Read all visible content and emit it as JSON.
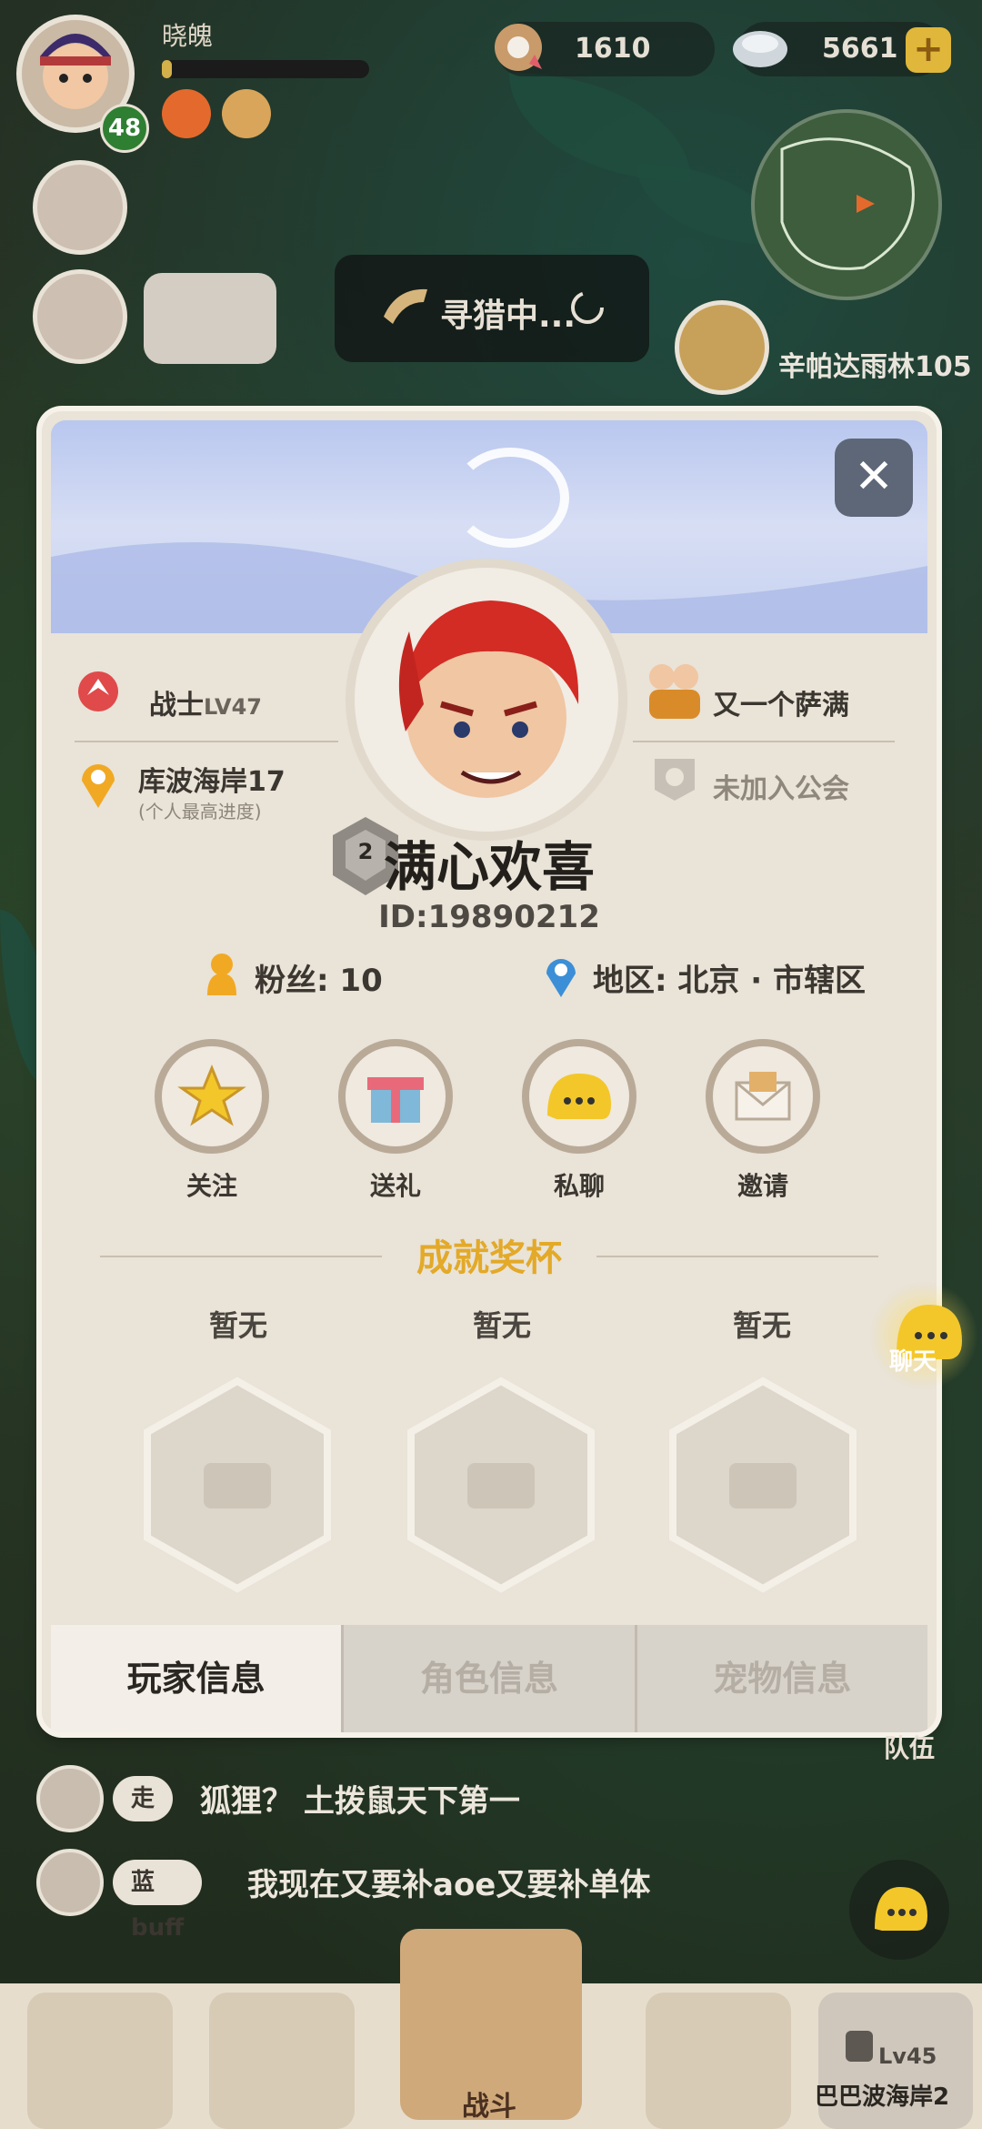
{
  "hud": {
    "player_name": "晓魄",
    "player_level": "48",
    "exp_progress": 0.05,
    "shells": "1610",
    "pearls": "5661",
    "hunting_text": "寻猎中...",
    "location_label": "辛帕达雨林105"
  },
  "profile": {
    "class_label": "战士",
    "class_level": "LV47",
    "best_progress": "库波海岸17",
    "best_progress_sub": "(个人最高进度)",
    "partner_label": "又一个萨满",
    "guild_label": "未加入公会",
    "rank_badge": "2",
    "nickname": "满心欢喜",
    "id_text": "ID:19890212",
    "fans_label": "粉丝: 10",
    "region_label": "地区: 北京 · 市辖区",
    "actions": [
      {
        "label": "关注",
        "icon": "star-icon"
      },
      {
        "label": "送礼",
        "icon": "gift-icon"
      },
      {
        "label": "私聊",
        "icon": "chat-icon"
      },
      {
        "label": "邀请",
        "icon": "invite-icon"
      }
    ],
    "achievement_title": "成就奖杯",
    "trophies": [
      "暂无",
      "暂无",
      "暂无"
    ],
    "tabs": [
      "玩家信息",
      "角色信息",
      "宠物信息"
    ],
    "active_tab": 0
  },
  "side": {
    "chat_label": "聊天",
    "team_label": "队伍"
  },
  "chat": [
    {
      "tag": "走",
      "text": "狐狸？ 土拨鼠天下第一"
    },
    {
      "tag": "蓝buff",
      "text": "我现在又要补aoe又要补单体"
    }
  ],
  "bottom": {
    "battle_label": "战斗",
    "locked_level": "Lv45",
    "locked_area": "巴巴波海岸2"
  },
  "colors": {
    "panel_bg": "#e9e3d8",
    "accent_gold": "#e3a928",
    "level_badge": "#2f7f32"
  }
}
